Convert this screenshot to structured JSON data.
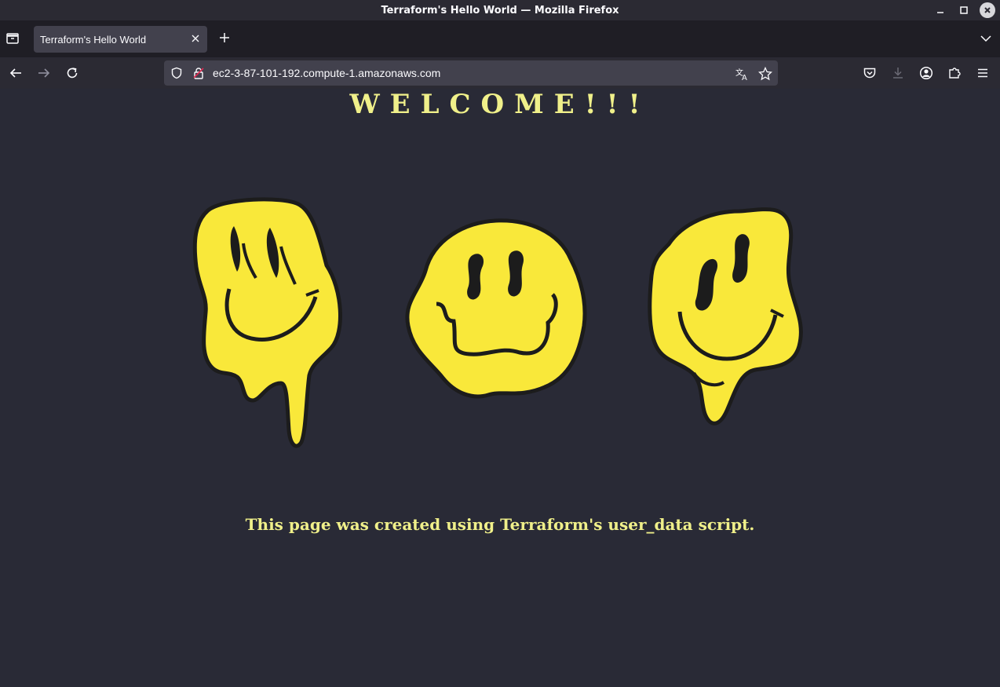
{
  "window": {
    "title": "Terraform's Hello World — Mozilla Firefox"
  },
  "tabs": [
    {
      "label": "Terraform's Hello World"
    }
  ],
  "urlbar": {
    "url": "ec2-3-87-101-192.compute-1.amazonaws.com"
  },
  "icons": {
    "minimize": "minimize-icon",
    "maximize": "maximize-icon",
    "close": "close-icon",
    "tab_list": "tab-list-icon",
    "new_tab": "plus-icon",
    "back": "back-arrow-icon",
    "forward": "forward-arrow-icon",
    "reload": "reload-icon",
    "shield": "shield-icon",
    "lock": "lock-icon",
    "translate": "translate-icon",
    "bookmark": "star-icon",
    "pocket": "pocket-icon",
    "downloads": "download-icon",
    "account": "account-icon",
    "extensions": "puzzle-icon",
    "menu": "hamburger-icon"
  },
  "page": {
    "heading": "WELCOME!!!",
    "subtitle": "This page was created using Terraform's user_data script."
  },
  "colors": {
    "page_background": "#292a36",
    "text_accent": "#f0f08a",
    "smiley_yellow": "#f9e83a",
    "smiley_ink": "#1c1c1c"
  }
}
